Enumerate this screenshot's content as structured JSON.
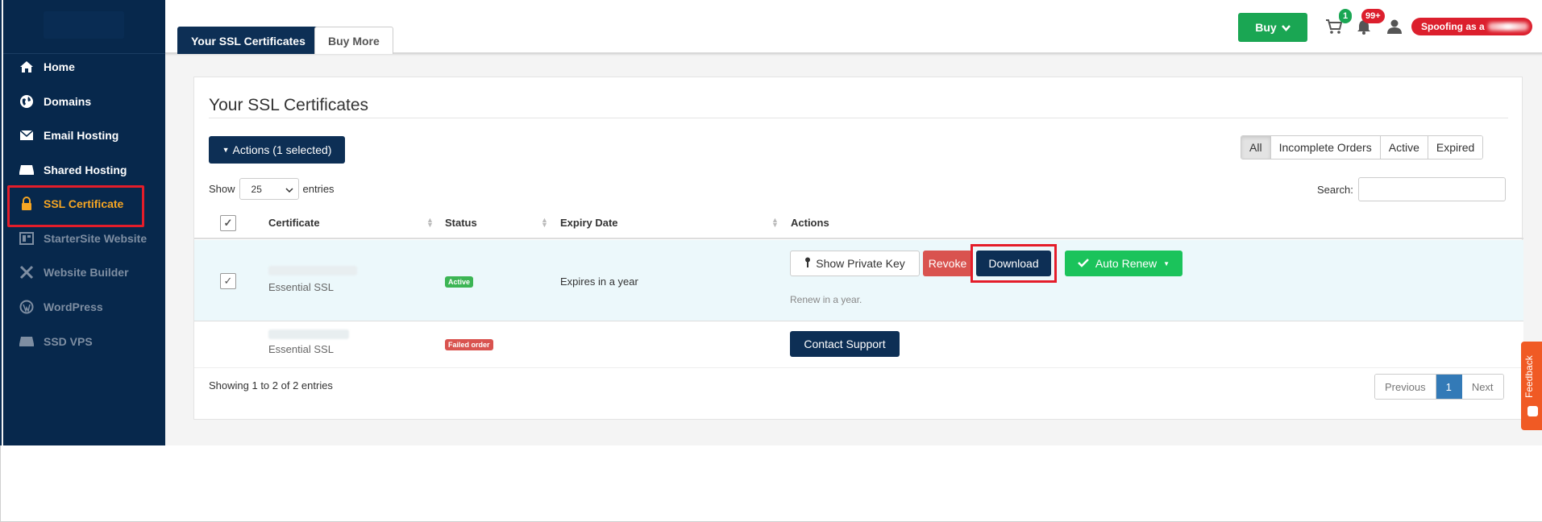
{
  "sidebar": {
    "items": [
      {
        "label": "Home",
        "icon": "home-icon"
      },
      {
        "label": "Domains",
        "icon": "globe-icon"
      },
      {
        "label": "Email Hosting",
        "icon": "envelope-icon"
      },
      {
        "label": "Shared Hosting",
        "icon": "server-icon"
      },
      {
        "label": "SSL Certificate",
        "icon": "lock-icon"
      },
      {
        "label": "StarterSite Website",
        "icon": "layout-icon"
      },
      {
        "label": "Website Builder",
        "icon": "tools-icon"
      },
      {
        "label": "WordPress",
        "icon": "wordpress-icon"
      },
      {
        "label": "SSD VPS",
        "icon": "vps-icon"
      }
    ]
  },
  "topbar": {
    "tabs": [
      {
        "label": "Your SSL Certificates"
      },
      {
        "label": "Buy More"
      }
    ],
    "buy_label": "Buy",
    "cart_count": "1",
    "notifications_count": "99+",
    "spoof_label": "Spoofing as a"
  },
  "panel": {
    "title": "Your SSL Certificates",
    "actions_label": "Actions (1 selected)",
    "filters": [
      "All",
      "Incomplete Orders",
      "Active",
      "Expired"
    ],
    "show_label": "Show",
    "entries_value": "25",
    "entries_label": "entries",
    "search_label": "Search:",
    "columns": [
      "Certificate",
      "Status",
      "Expiry Date",
      "Actions"
    ],
    "rows": [
      {
        "certificate": "Essential SSL",
        "status": "Active",
        "expiry": "Expires in a year",
        "buttons": {
          "show_key": "Show Private Key",
          "revoke": "Revoke",
          "download": "Download",
          "auto_renew": "Auto Renew"
        },
        "note": "Renew in a year."
      },
      {
        "certificate": "Essential SSL",
        "status": "Failed order",
        "expiry": "",
        "buttons": {
          "support": "Contact Support"
        }
      }
    ],
    "showing": "Showing 1 to 2 of 2 entries",
    "pager": {
      "previous": "Previous",
      "current": "1",
      "next": "Next"
    }
  },
  "feedback_label": "Feedback",
  "colors": {
    "navy": "#0d2f55",
    "sidebar": "#07284c",
    "accent_orange": "#f6a623",
    "green": "#1aa653",
    "red": "#d9534f",
    "highlight_red": "#e41d2a"
  }
}
